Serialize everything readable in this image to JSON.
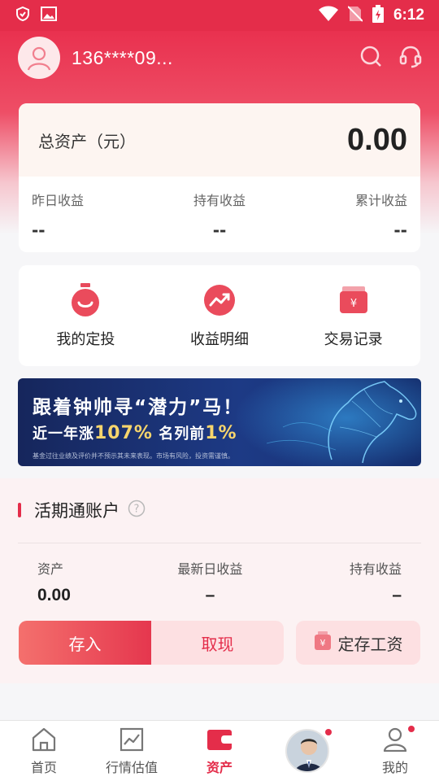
{
  "status_bar": {
    "time": "6:12",
    "left_icons": [
      "shield-check-icon",
      "image-icon"
    ],
    "right_icons": [
      "wifi-icon",
      "no-sim-icon",
      "battery-charging-icon"
    ]
  },
  "header": {
    "phone": "136****09...",
    "icons": [
      "search-icon",
      "customer-service-icon"
    ]
  },
  "total_assets": {
    "title": "总资产（元）",
    "value": "0.00",
    "stats": [
      {
        "label": "昨日收益",
        "value": "--"
      },
      {
        "label": "持有收益",
        "value": "--"
      },
      {
        "label": "累计收益",
        "value": "--"
      }
    ]
  },
  "shortcuts": [
    {
      "label": "我的定投",
      "icon": "timer-icon"
    },
    {
      "label": "收益明细",
      "icon": "trend-up-icon"
    },
    {
      "label": "交易记录",
      "icon": "wallet-icon"
    }
  ],
  "banner": {
    "title": "跟着钟帅寻“潜力”马！",
    "sub_prefix": "近一年涨",
    "sub_highlight1": "107%",
    "sub_middle": "名列前",
    "sub_highlight2": "1%",
    "note": "基金过往业绩及评价并不预示其未来表现。市场有风险，投资需谨慎。"
  },
  "current_account": {
    "title": "活期通账户",
    "stats": [
      {
        "label": "资产",
        "value": "0.00"
      },
      {
        "label": "最新日收益",
        "value": "–"
      },
      {
        "label": "持有收益",
        "value": "–"
      }
    ],
    "deposit_label": "存入",
    "withdraw_label": "取现",
    "salary_label": "定存工资"
  },
  "tabbar": {
    "items": [
      {
        "label": "首页",
        "icon": "home-icon",
        "active": false
      },
      {
        "label": "行情估值",
        "icon": "chart-icon",
        "active": false
      },
      {
        "label": "资产",
        "icon": "wallet-icon",
        "active": true
      },
      {
        "label": "",
        "icon": "advisor-avatar",
        "active": false
      },
      {
        "label": "我的",
        "icon": "person-icon",
        "active": false
      }
    ]
  },
  "colors": {
    "brand_red": "#e42d4a",
    "highlight_gold": "#f7d56c"
  }
}
